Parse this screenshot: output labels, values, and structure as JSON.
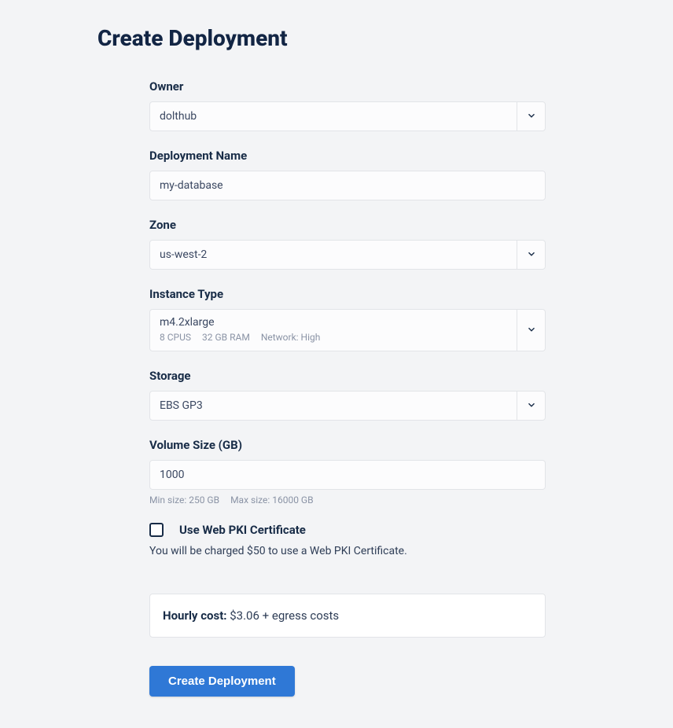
{
  "page": {
    "title": "Create Deployment"
  },
  "owner": {
    "label": "Owner",
    "value": "dolthub"
  },
  "deployment_name": {
    "label": "Deployment Name",
    "value": "my-database"
  },
  "zone": {
    "label": "Zone",
    "value": "us-west-2"
  },
  "instance_type": {
    "label": "Instance Type",
    "value": "m4.2xlarge",
    "meta": {
      "cpus": "8 CPUS",
      "ram": "32 GB RAM",
      "network": "Network: High"
    }
  },
  "storage": {
    "label": "Storage",
    "value": "EBS GP3"
  },
  "volume_size": {
    "label": "Volume Size (GB)",
    "value": "1000",
    "min_hint": "Min size: 250 GB",
    "max_hint": "Max size: 16000 GB"
  },
  "pki": {
    "label": "Use Web PKI Certificate",
    "note": "You will be charged $50 to use a Web PKI Certificate.",
    "checked": false
  },
  "cost": {
    "label": "Hourly cost:",
    "amount": "$3.06 + egress costs"
  },
  "submit": {
    "label": "Create Deployment"
  }
}
